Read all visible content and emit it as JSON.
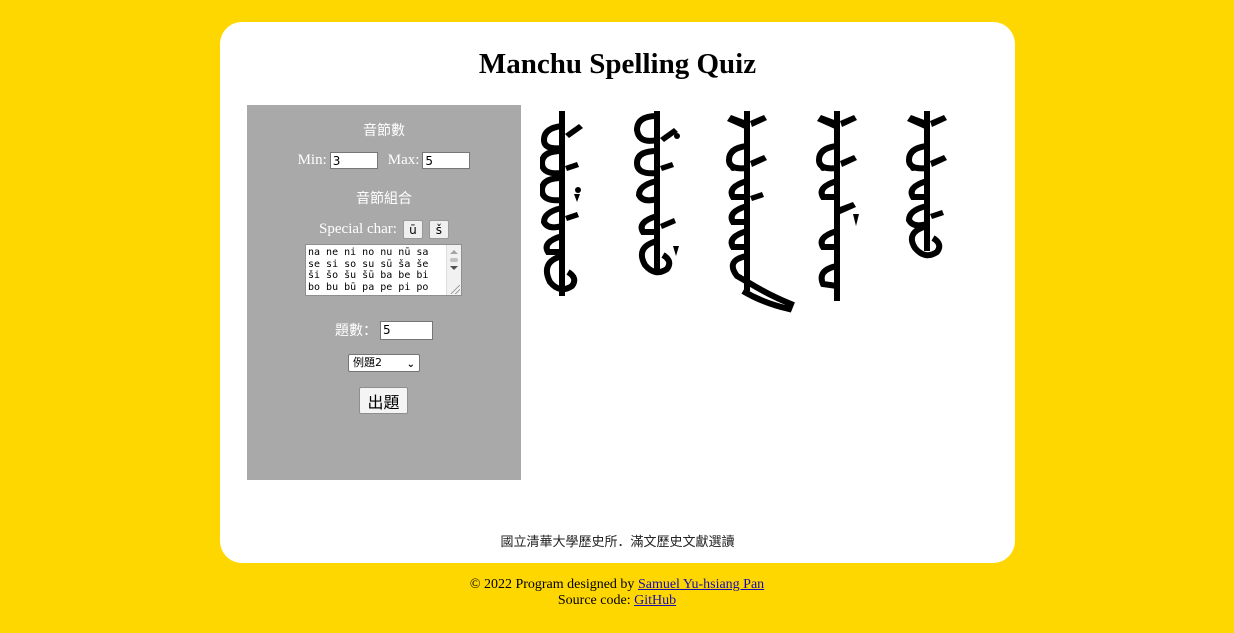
{
  "page": {
    "title": "Manchu Spelling Quiz",
    "background_color": "#FFD700"
  },
  "settings": {
    "syllable_count_heading": "音節數",
    "min_label": "Min:",
    "min_value": "3",
    "max_label": "Max:",
    "max_value": "5",
    "syllable_combo_heading": "音節組合",
    "special_char_label": "Special char:",
    "special_chars": [
      "ū",
      "š"
    ],
    "syllables_text": "na ne ni no nu nū sa se si so su sū ša še ši šo šu šū ba be bi bo bu bū pa pe pi po",
    "question_count_label": "題數：",
    "question_count_value": "5",
    "example_select_value": "例題2",
    "generate_button_label": "出題",
    "panel_color": "#a9a9a9"
  },
  "quiz": {
    "words_shown": 5,
    "script": "Manchu (vertical)"
  },
  "footer": {
    "org_text": "國立清華大學歷史所．滿文歷史文獻選讀",
    "copyright_prefix": "© 2022 Program designed by ",
    "author_link": "Samuel Yu-hsiang Pan",
    "source_prefix": "Source code: ",
    "source_link": "GitHub"
  }
}
